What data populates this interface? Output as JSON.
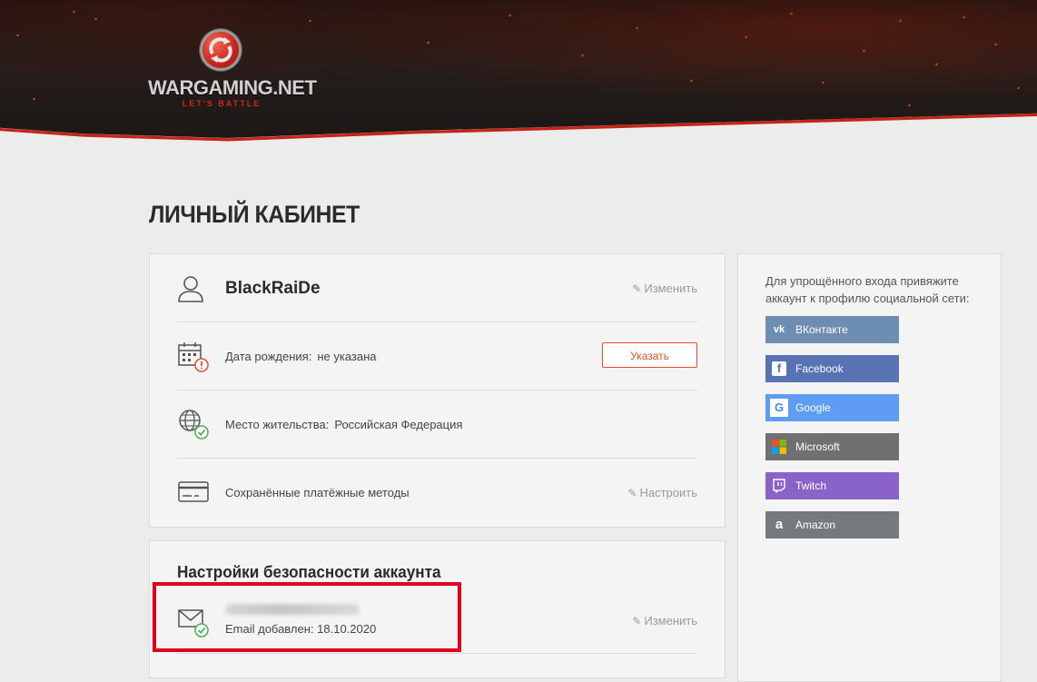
{
  "header": {
    "logo_text": "WARGAMING.NET",
    "logo_tagline": "LET'S BATTLE"
  },
  "page": {
    "title": "ЛИЧНЫЙ КАБИНЕТ"
  },
  "profile": {
    "username": "BlackRaiDe",
    "edit_label": "Изменить",
    "birth_label": "Дата рождения:",
    "birth_value": "не указана",
    "specify_button": "Указать",
    "residence_label": "Место жительства:",
    "residence_value": "Российская Федерация",
    "payment_label": "Сохранённые платёжные методы",
    "configure_label": "Настроить"
  },
  "security": {
    "title": "Настройки безопасности аккаунта",
    "email_added": "Email добавлен: 18.10.2020",
    "edit_label": "Изменить"
  },
  "social": {
    "hint": "Для упрощённого входа привяжите аккаунт к профилю социальной сети:",
    "buttons": [
      {
        "label": "ВКонтакте",
        "icon": "vk-icon",
        "color": "#6d8db3"
      },
      {
        "label": "Facebook",
        "icon": "facebook-icon",
        "color": "#5872b3"
      },
      {
        "label": "Google",
        "icon": "google-icon",
        "color": "#5f9cf4"
      },
      {
        "label": "Microsoft",
        "icon": "microsoft-icon",
        "color": "#707070"
      },
      {
        "label": "Twitch",
        "icon": "twitch-icon",
        "color": "#8a63c9"
      },
      {
        "label": "Amazon",
        "icon": "amazon-icon",
        "color": "#757a7f"
      }
    ]
  },
  "colors": {
    "accent": "#e1502a",
    "highlight": "#e0001b"
  }
}
